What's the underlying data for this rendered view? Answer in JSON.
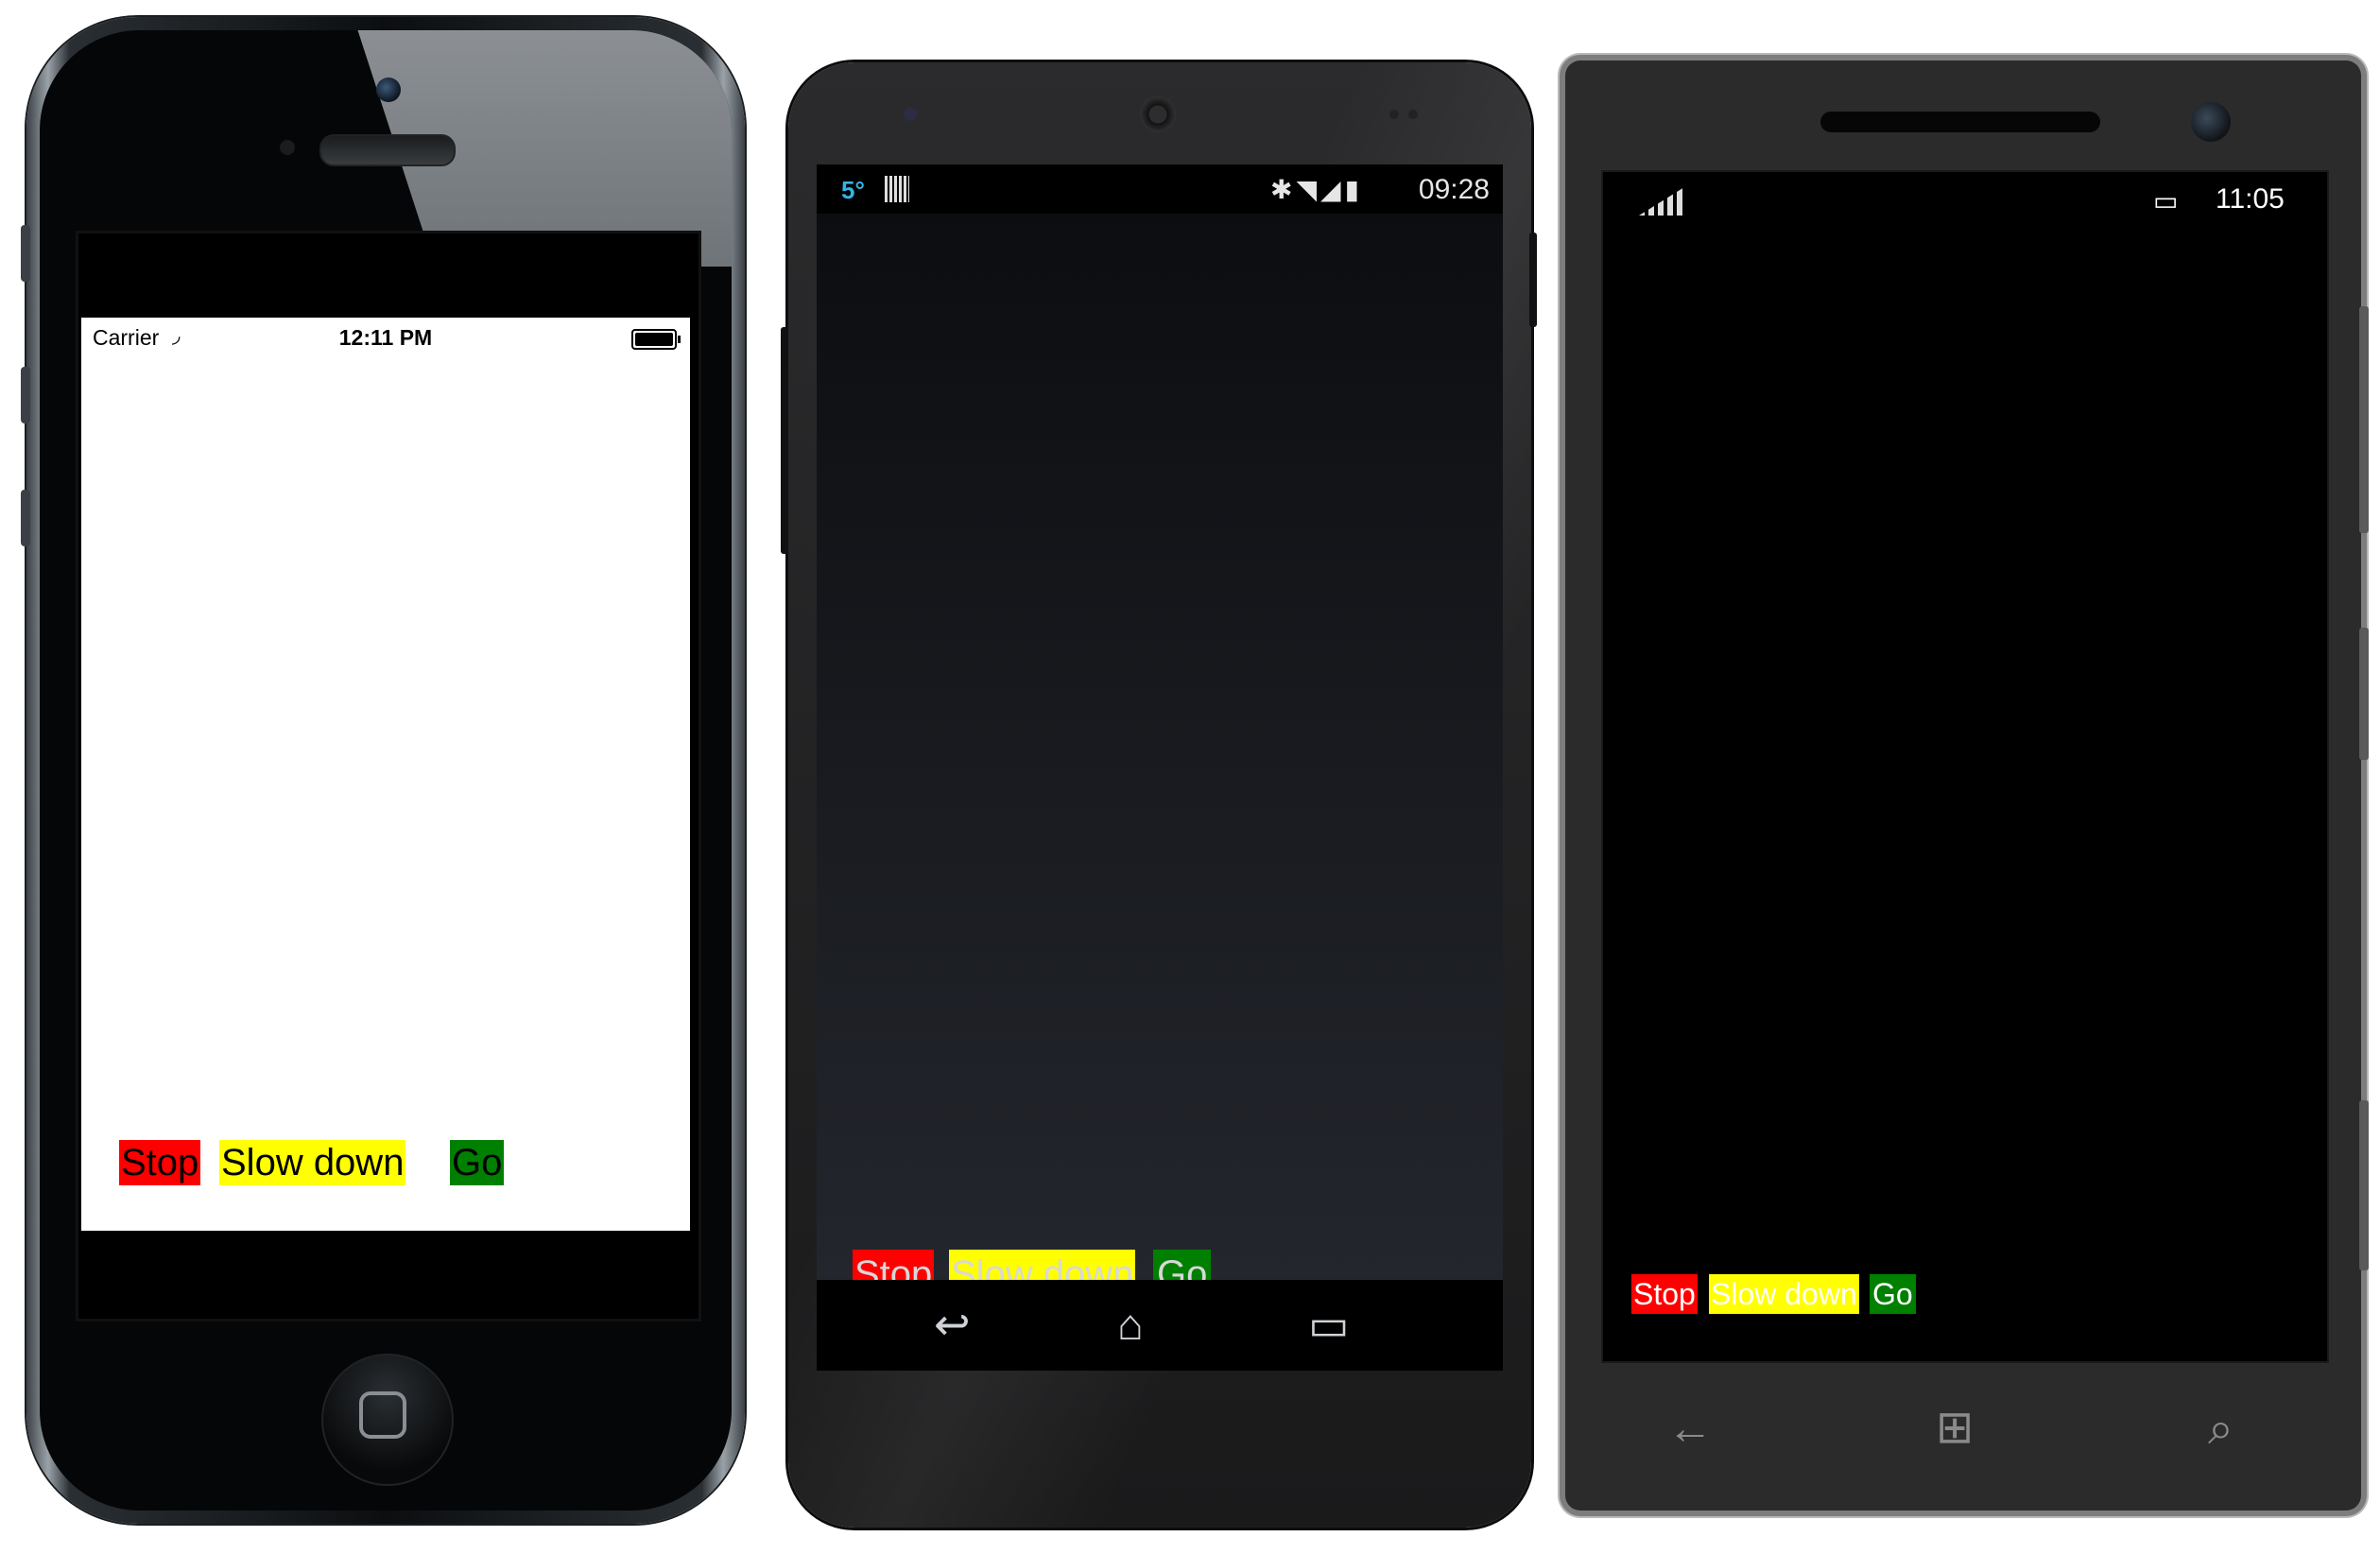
{
  "ios": {
    "status": {
      "carrier": "Carrier",
      "time": "12:11 PM"
    },
    "labels": {
      "stop": "Stop",
      "slow": "Slow down",
      "go": "Go"
    }
  },
  "android": {
    "status": {
      "temp": "5°",
      "time": "09:28"
    },
    "labels": {
      "stop": "Stop",
      "slow": "Slow down",
      "go": "Go"
    }
  },
  "winphone": {
    "status": {
      "time": "11:05"
    },
    "labels": {
      "stop": "Stop",
      "slow": "Slow down",
      "go": "Go"
    }
  },
  "colors": {
    "stop": "#ff0000",
    "slow": "#ffff00",
    "go": "#008000"
  },
  "icons": {
    "ios": [
      "wifi-icon",
      "battery-icon",
      "home-button-icon"
    ],
    "android": [
      "barcode-icon",
      "bluetooth-icon",
      "wifi-icon",
      "signal-icon",
      "battery-icon",
      "back-icon",
      "home-icon",
      "recents-icon"
    ],
    "winphone": [
      "signal-icon",
      "battery-icon",
      "back-icon",
      "windows-icon",
      "search-icon"
    ]
  }
}
